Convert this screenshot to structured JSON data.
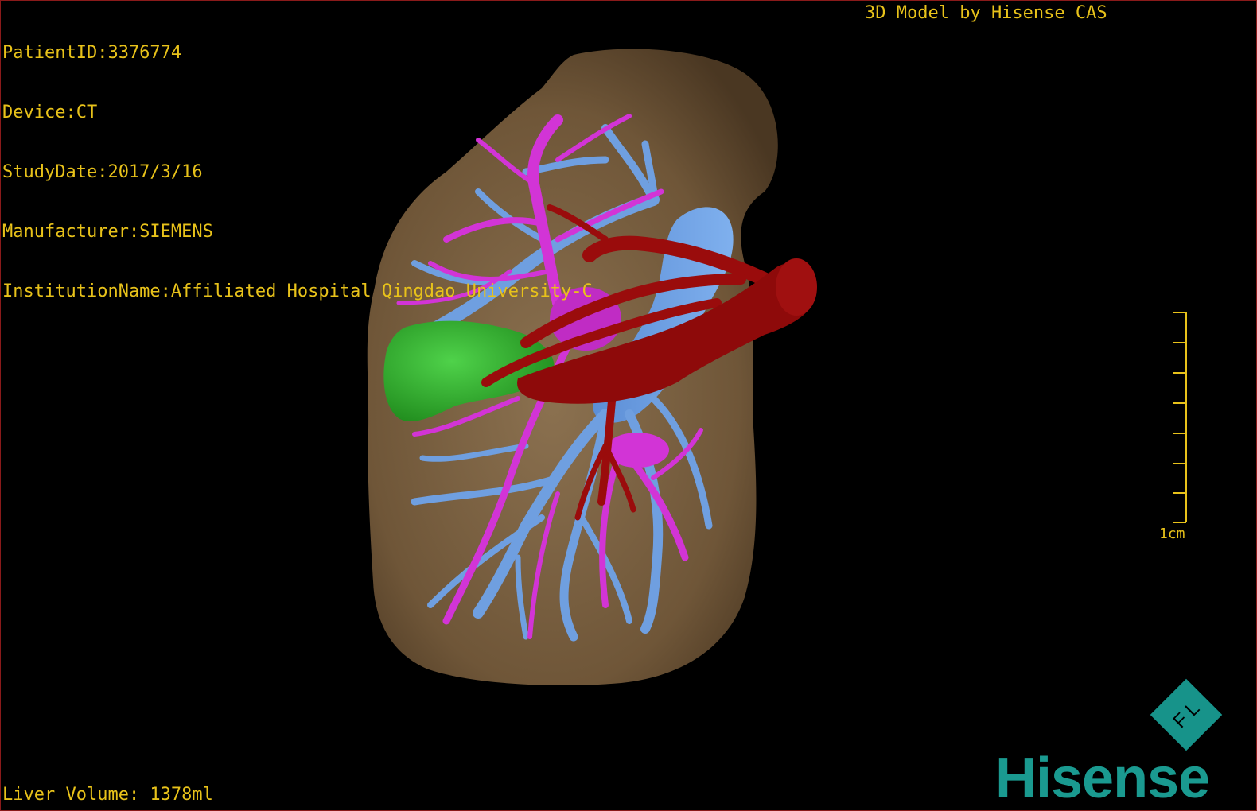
{
  "overlay": {
    "patient_id": "PatientID:3376774",
    "device": "Device:CT",
    "study_date": "StudyDate:2017/3/16",
    "manufacturer": "Manufacturer:SIEMENS",
    "institution": "InstitutionName:Affiliated Hospital Qingdao University-C",
    "credit": "3D Model by Hisense CAS",
    "liver_volume": "Liver Volume: 1378ml",
    "scale_label": "1cm"
  },
  "brand": {
    "logo_text": "Hisense",
    "badge_text": "F L"
  },
  "colors": {
    "overlay_text": "#e8c21a",
    "liver": "#7d6343",
    "portal_vein": "#6f9fe0",
    "hepatic_artery_biliary": "#d234d6",
    "artery": "#9a0c0c",
    "gallbladder": "#2fb02a",
    "brand": "#1a9a90"
  }
}
